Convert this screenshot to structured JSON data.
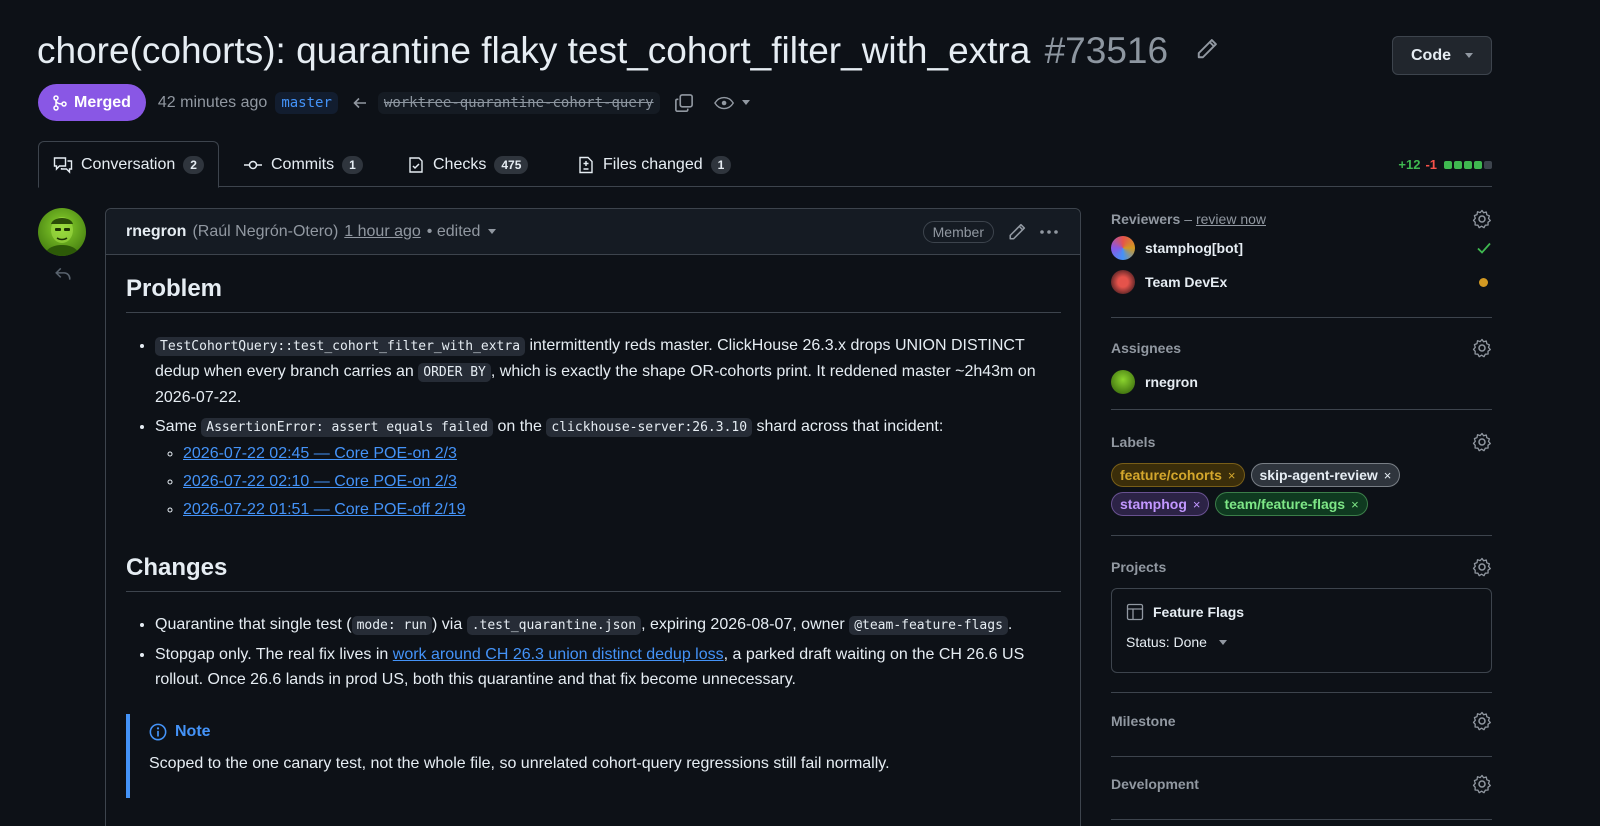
{
  "header": {
    "title": "chore(cohorts): quarantine flaky test_cohort_filter_with_extra",
    "number": "#73516",
    "code_button": "Code"
  },
  "meta": {
    "state": "Merged",
    "time": "42 minutes ago",
    "base_branch": "master",
    "head_branch": "worktree-quarantine-cohort-query"
  },
  "tabs": [
    {
      "label": "Conversation",
      "count": "2"
    },
    {
      "label": "Commits",
      "count": "1"
    },
    {
      "label": "Checks",
      "count": "475"
    },
    {
      "label": "Files changed",
      "count": "1"
    }
  ],
  "diffstat": {
    "additions": "+12",
    "deletions": "-1",
    "blocks": [
      "#3fb950",
      "#3fb950",
      "#3fb950",
      "#3fb950",
      "#3d444d"
    ]
  },
  "comment": {
    "author": "rnegron",
    "full_name": "(Raúl Negrón-Otero)",
    "time": "1 hour ago",
    "edited": "• edited",
    "badge": "Member",
    "problem_heading": "Problem",
    "p1_code": "TestCohortQuery::test_cohort_filter_with_extra",
    "p1_text_a": " intermittently reds master. ClickHouse 26.3.x drops UNION DISTINCT dedup when every branch carries an ",
    "p1_code2": "ORDER BY",
    "p1_text_b": ", which is exactly the shape OR-cohorts print. It reddened master ~2h43m on 2026-07-22.",
    "p2_text_a": "Same ",
    "p2_code": "AssertionError: assert equals failed",
    "p2_text_b": " on the ",
    "p2_code2": "clickhouse-server:26.3.10",
    "p2_text_c": " shard across that incident:",
    "incidents": [
      "2026-07-22 02:45 — Core POE-on 2/3",
      "2026-07-22 02:10 — Core POE-on 2/3",
      "2026-07-22 01:51 — Core POE-off 2/19"
    ],
    "changes_heading": "Changes",
    "c1_text_a": "Quarantine that single test (",
    "c1_code": "mode: run",
    "c1_text_b": ") via ",
    "c1_code2": ".test_quarantine.json",
    "c1_text_c": ", expiring 2026-08-07, owner ",
    "c1_code3": "@team-feature-flags",
    "c1_text_d": ".",
    "c2_text_a": "Stopgap only. The real fix lives in ",
    "c2_link": "work around CH 26.3 union distinct dedup loss",
    "c2_text_b": ", a parked draft waiting on the CH 26.6 US rollout. Once 26.6 lands in prod US, both this quarantine and that fix become unnecessary.",
    "note_title": "Note",
    "note_text": "Scoped to the one canary test, not the whole file, so unrelated cohort-query regressions still fail normally."
  },
  "sidebar": {
    "reviewers_title": "Reviewers",
    "reviewers_dash": "–",
    "review_now": "review now",
    "reviewers": [
      {
        "name": "stamphog[bot]",
        "status": "approved"
      },
      {
        "name": "Team DevEx",
        "status": "pending"
      }
    ],
    "assignees_title": "Assignees",
    "assignee": "rnegron",
    "labels_title": "Labels",
    "labels": [
      {
        "name": "feature/cohorts",
        "color": "#d4a72c",
        "bg": "#3b2e0a"
      },
      {
        "name": "skip-agent-review",
        "color": "#e6edf3",
        "bg": "#2f353d"
      },
      {
        "name": "stamphog",
        "color": "#c297ff",
        "bg": "#2c2346"
      },
      {
        "name": "team/feature-flags",
        "color": "#7ee787",
        "bg": "#0f3a20"
      }
    ],
    "label_remove": "×",
    "projects_title": "Projects",
    "project_name": "Feature Flags",
    "project_status": "Status: Done",
    "milestone_title": "Milestone",
    "development_title": "Development"
  },
  "colors": {
    "merged": "#8957e5",
    "link": "#4493f8",
    "bg": "#0d1117"
  }
}
